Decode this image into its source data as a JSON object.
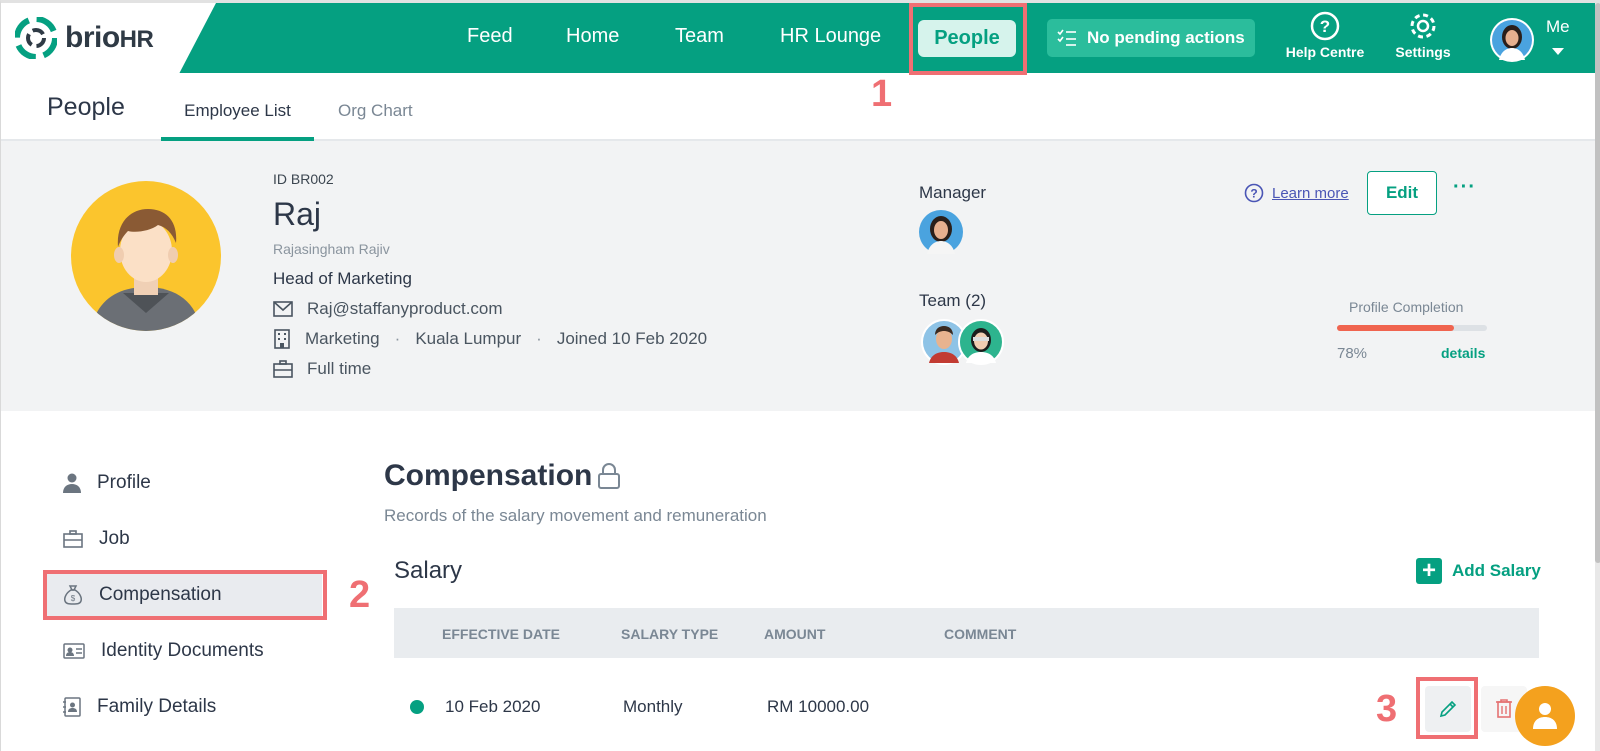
{
  "brand": {
    "name_part1": "brio",
    "name_part2": "HR"
  },
  "topnav": {
    "items": [
      "Feed",
      "Home",
      "Team",
      "HR Lounge",
      "People"
    ],
    "pending": "No pending actions",
    "help": "Help Centre",
    "settings": "Settings",
    "me": "Me"
  },
  "subnav": {
    "title": "People",
    "tabs": [
      "Employee List",
      "Org Chart"
    ],
    "active_tab": "Employee List"
  },
  "employee": {
    "id": "ID BR002",
    "name": "Raj",
    "full_name": "Rajasingham Rajiv",
    "title": "Head of Marketing",
    "email": "Raj@staffanyproduct.com",
    "department": "Marketing",
    "location": "Kuala Lumpur",
    "joined": "Joined 10 Feb 2020",
    "employment_type": "Full time",
    "manager_label": "Manager",
    "team_label": "Team (2)"
  },
  "actions": {
    "learn_more": "Learn more",
    "edit": "Edit",
    "more": "···"
  },
  "profile_completion": {
    "label": "Profile Completion",
    "percent_text": "78%",
    "percent": 78,
    "details": "details"
  },
  "side_menu": [
    "Profile",
    "Job",
    "Compensation",
    "Identity Documents",
    "Family Details"
  ],
  "side_menu_active": "Compensation",
  "compensation": {
    "title": "Compensation",
    "subtitle": "Records of the salary movement and remuneration",
    "salary_heading": "Salary",
    "add_salary": "Add Salary",
    "columns": [
      "EFFECTIVE DATE",
      "SALARY TYPE",
      "AMOUNT",
      "COMMENT"
    ],
    "rows": [
      {
        "effective_date": "10 Feb 2020",
        "salary_type": "Monthly",
        "amount": "RM 10000.00",
        "comment": ""
      }
    ]
  },
  "annotations": {
    "step1": "1",
    "step2": "2",
    "step3": "3"
  },
  "colors": {
    "brand_green": "#05a081",
    "annotation_red": "#ef6f73",
    "fab_orange": "#f4a11e",
    "progress_fill": "#f0644f"
  }
}
